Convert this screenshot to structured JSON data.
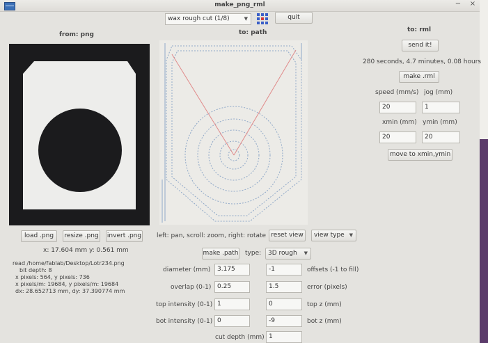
{
  "window": {
    "title": "make_png_rml"
  },
  "header": {
    "mode_select": "wax rough cut (1/8)",
    "quit_label": "quit"
  },
  "columns": {
    "from": "from: png",
    "to_path": "to: path",
    "to_rml": "to: rml"
  },
  "rml": {
    "send_label": "send it!",
    "estimate": "280 seconds, 4.7 minutes, 0.08 hours",
    "make_rml_label": "make .rml",
    "speed_label": "speed (mm/s)",
    "jog_label": "jog (mm)",
    "speed_value": "20",
    "jog_value": "1",
    "xmin_label": "xmin (mm)",
    "ymin_label": "ymin (mm)",
    "xmin_value": "20",
    "ymin_value": "20",
    "move_label": "move to xmin,ymin"
  },
  "png_controls": {
    "load_label": "load .png",
    "resize_label": "resize .png",
    "invert_label": "invert .png",
    "coords": "x: 17.604 mm y: 0.561 mm",
    "info": [
      "read /home/fablab/Desktop/Lotr234.png",
      "bit depth: 8",
      "x pixels: 564, y pixels: 736",
      "x pixels/m: 19684, y pixels/m: 19684",
      "dx: 28.652713 mm, dy: 37.390774 mm"
    ]
  },
  "path_controls": {
    "hint": "left: pan, scroll: zoom, right: rotate",
    "reset_view_label": "reset view",
    "view_type_label": "view type",
    "make_path_label": "make .path",
    "type_label": "type:",
    "type_value": "3D rough"
  },
  "params": {
    "diameter_label": "diameter (mm)",
    "diameter_value": "3.175",
    "offsets_value": "-1",
    "offsets_label": "offsets (-1 to fill)",
    "overlap_label": "overlap (0-1)",
    "overlap_value": "0.25",
    "error_value": "1.5",
    "error_label": "error (pixels)",
    "top_intensity_label": "top intensity (0-1)",
    "top_intensity_value": "1",
    "top_z_value": "0",
    "top_z_label": "top z (mm)",
    "bot_intensity_label": "bot intensity (0-1)",
    "bot_intensity_value": "0",
    "bot_z_value": "-9",
    "bot_z_label": "bot z (mm)",
    "cut_depth_label": "cut depth (mm)",
    "cut_depth_value": "1"
  },
  "icons": {
    "menu": "window-menu-icon",
    "grid": "grid-icon",
    "minimize": "minimize-icon",
    "close": "close-icon"
  },
  "colors": {
    "grid_icon": "#3a5fc8",
    "grid_icon_accent": "#d23a3a",
    "path_lines": "#8fa8c8",
    "path_accent": "#e08a8a",
    "png_black": "#1b1b1d",
    "png_white": "#ededeb"
  }
}
